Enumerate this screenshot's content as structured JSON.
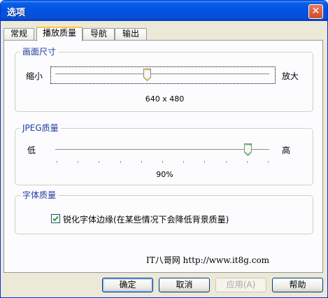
{
  "window": {
    "title": "选项",
    "close_label": "✕"
  },
  "tabs": [
    {
      "label": "常规",
      "active": false
    },
    {
      "label": "播放质量",
      "active": true
    },
    {
      "label": "导航",
      "active": false
    },
    {
      "label": "输出",
      "active": false
    }
  ],
  "image_size": {
    "group_label": "画面尺寸",
    "min_label": "缩小",
    "max_label": "放大",
    "value_text": "640 x 480",
    "slider_fraction": 0.43
  },
  "jpeg_quality": {
    "group_label": "JPEG质量",
    "min_label": "低",
    "max_label": "高",
    "value_text": "90%",
    "slider_fraction": 0.9
  },
  "font_quality": {
    "group_label": "字体质量",
    "checkbox_label": "锐化字体边缘(在某些情况下会降低背景质量)",
    "checked": true
  },
  "watermark": "IT八哥网 http://www.it8g.com",
  "buttons": {
    "ok": "确定",
    "cancel": "取消",
    "apply": "应用(A)",
    "help": "帮助"
  },
  "colors": {
    "titlebar": "#0054e3",
    "group_label": "#1f3c9d",
    "checkmark": "#21a121"
  }
}
